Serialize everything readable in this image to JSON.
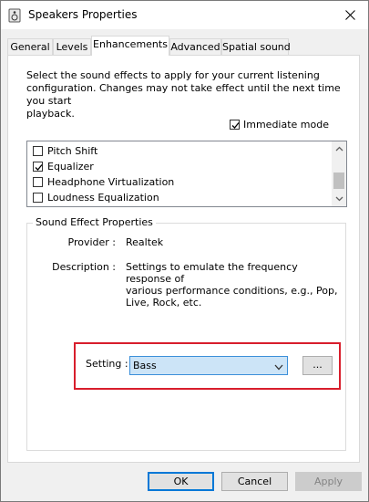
{
  "window": {
    "title": "Speakers Properties"
  },
  "tabs": [
    {
      "label": "General"
    },
    {
      "label": "Levels"
    },
    {
      "label": "Enhancements"
    },
    {
      "label": "Advanced"
    },
    {
      "label": "Spatial sound"
    }
  ],
  "enhancements": {
    "description_line1": "Select the sound effects to apply for your current listening",
    "description_line2": "configuration. Changes may not take effect until the next time you start",
    "description_line3": "playback.",
    "immediate_mode": {
      "label": "Immediate mode",
      "checked": true
    },
    "effects": [
      {
        "label": "Pitch Shift",
        "checked": false
      },
      {
        "label": "Equalizer",
        "checked": true
      },
      {
        "label": "Headphone Virtualization",
        "checked": false
      },
      {
        "label": "Loudness Equalization",
        "checked": false
      }
    ]
  },
  "properties": {
    "group_title": "Sound Effect Properties",
    "provider_label": "Provider :",
    "provider_value": "Realtek",
    "description_label": "Description :",
    "description_line1": "Settings to emulate the frequency response of",
    "description_line2": "various performance conditions,  e.g., Pop,",
    "description_line3": "Live, Rock, etc.",
    "setting_label": "Setting :",
    "setting_value": "Bass",
    "more_label": "..."
  },
  "buttons": {
    "ok": "OK",
    "cancel": "Cancel",
    "apply": "Apply"
  },
  "colors": {
    "highlight_border": "#d81e2c",
    "select_fill": "#cce4f7",
    "accent": "#0078d7"
  }
}
